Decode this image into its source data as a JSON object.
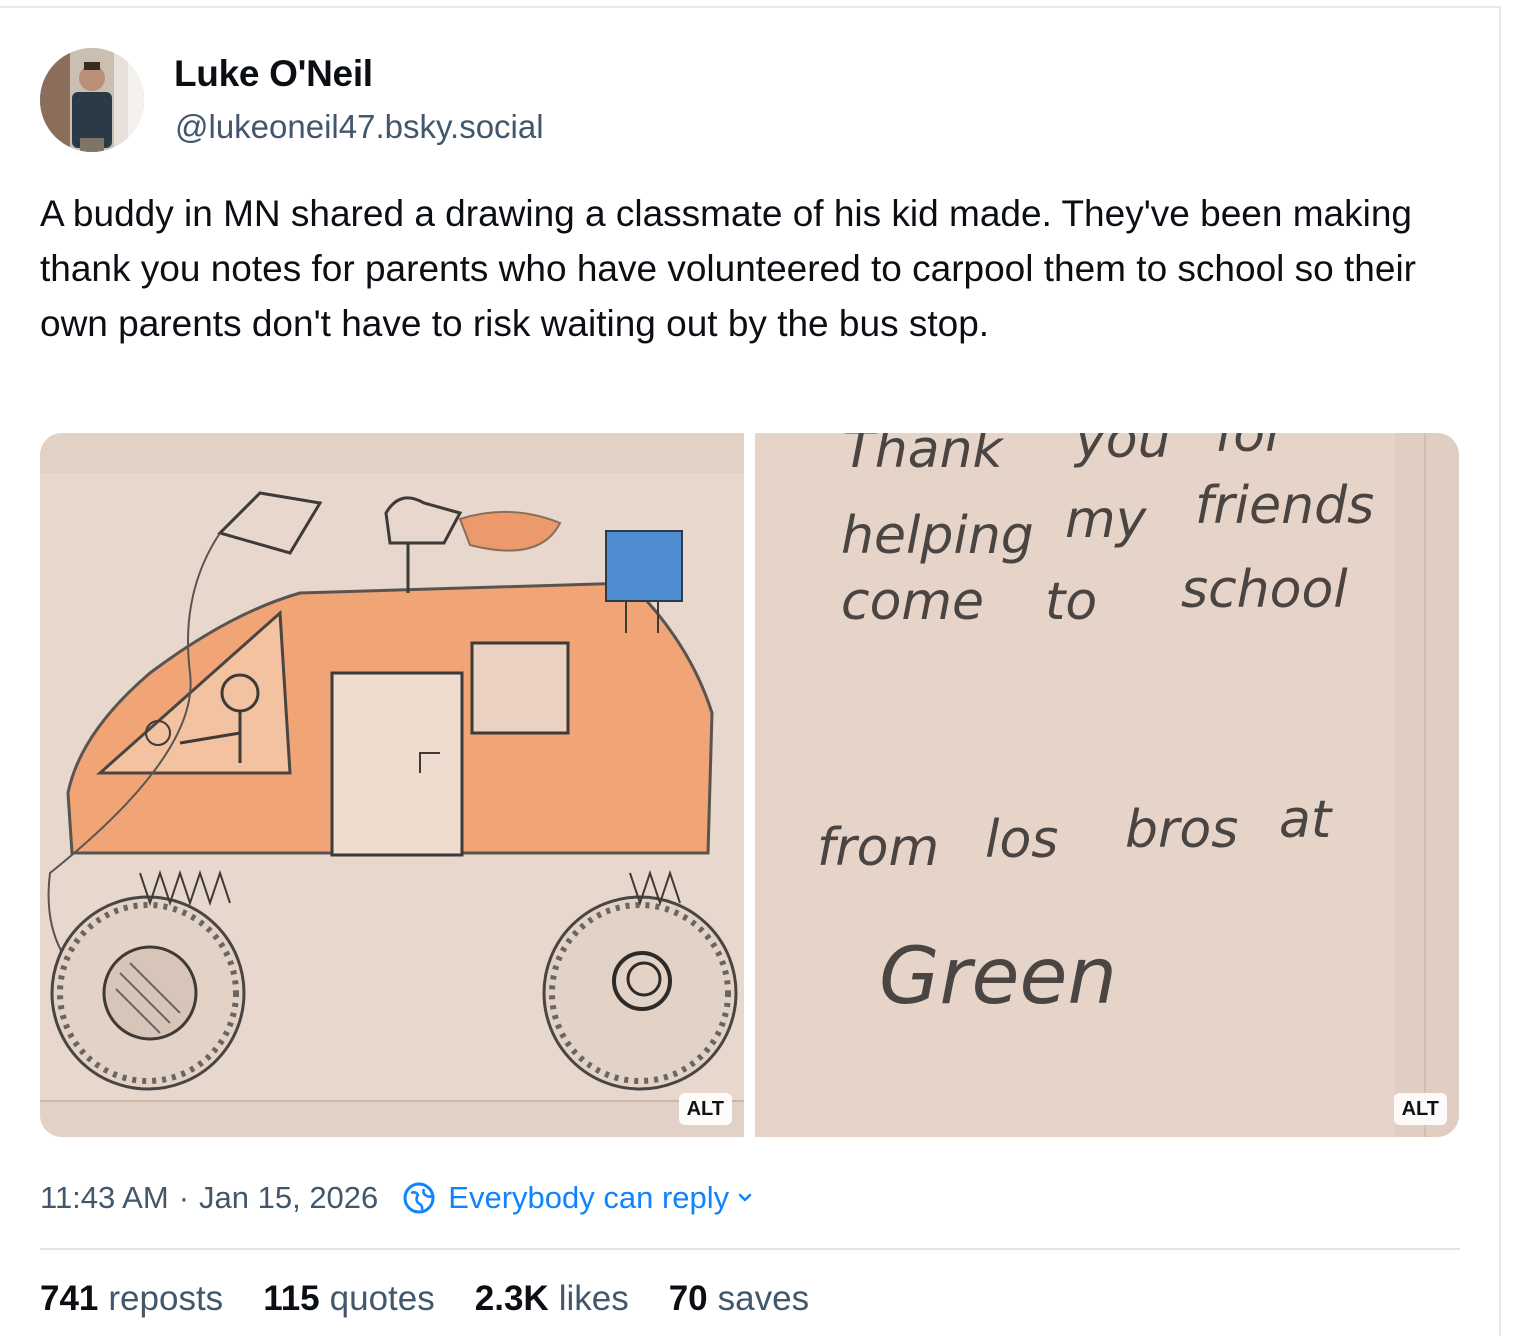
{
  "post": {
    "author": {
      "name": "Luke O'Neil",
      "handle": "@lukeoneil47.bsky.social"
    },
    "text": "A buddy in MN shared a drawing a classmate of his kid made. They've been making thank you notes for parents who have volunteered to carpool them to school so their own parents don't have to risk waiting out by the bus stop.",
    "images": [
      {
        "alt_badge": "ALT"
      },
      {
        "alt_badge": "ALT",
        "note_lines": [
          "Thank",
          "you",
          "for",
          "helping",
          "my",
          "friends",
          "come",
          "to",
          "school",
          "from",
          "los",
          "bros",
          "at",
          "Green"
        ]
      }
    ],
    "time": "11:43 AM",
    "separator": "·",
    "date": "Jan 15, 2026",
    "reply_setting": "Everybody can reply",
    "stats": {
      "reposts": {
        "count": "741",
        "label": "reposts"
      },
      "quotes": {
        "count": "115",
        "label": "quotes"
      },
      "likes": {
        "count": "2.3K",
        "label": "likes"
      },
      "saves": {
        "count": "70",
        "label": "saves"
      }
    }
  },
  "colors": {
    "text": "#0b0f14",
    "secondary": "#42576c",
    "link": "#1083fe",
    "divider": "#e2e6ea",
    "car": "#f1a577",
    "paper": "#e6d4c9"
  }
}
